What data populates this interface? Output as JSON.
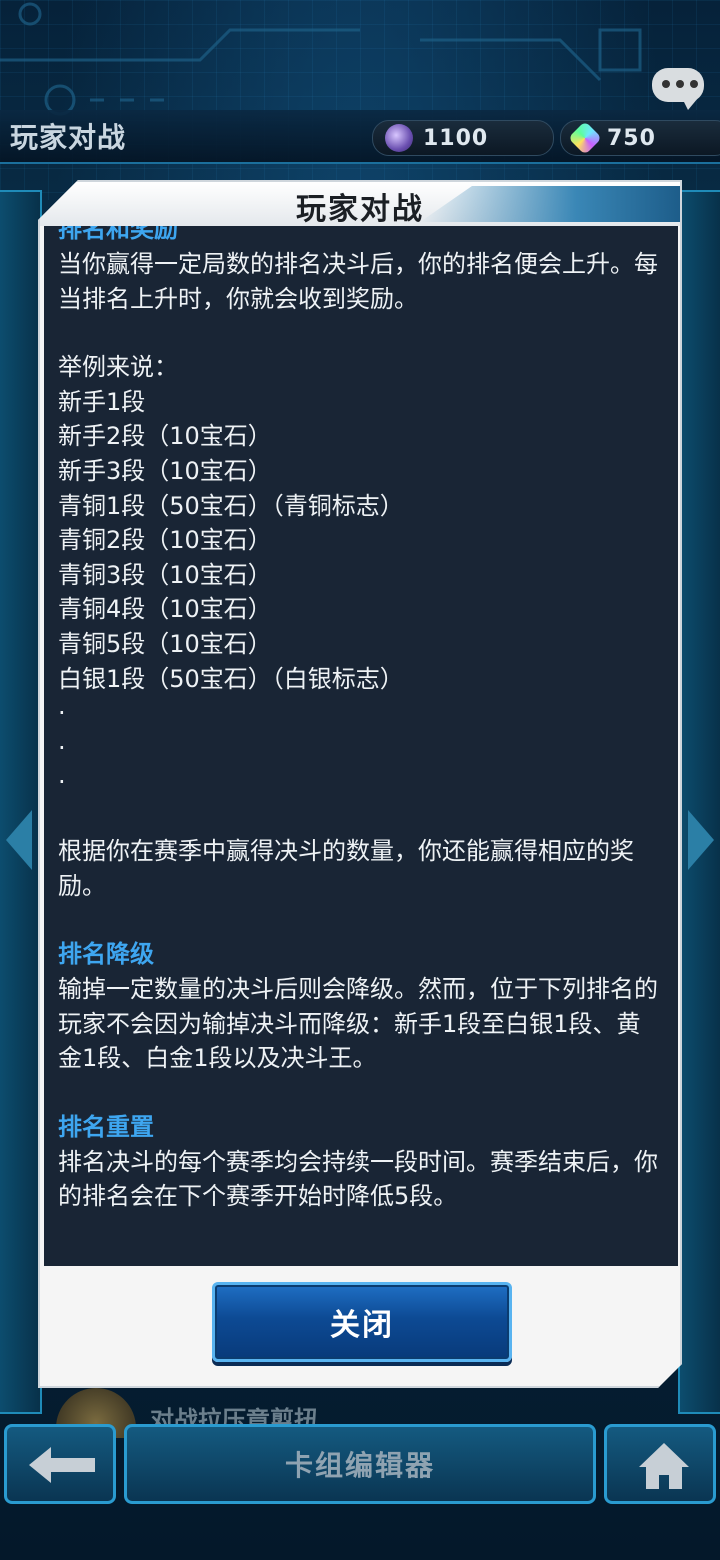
{
  "screen": {
    "title": "玩家对战",
    "currency": [
      {
        "icon": "orb-icon",
        "value": "1100"
      },
      {
        "icon": "gem-icon",
        "value": "750"
      }
    ],
    "bottom_peek_text": "对战拉压竟剪扭"
  },
  "nav": {
    "deck_editor_label": "卡组编辑器"
  },
  "dialog": {
    "title": "玩家对战",
    "sections": [
      {
        "heading": "排名和奖励",
        "paragraphs": [
          "当你赢得一定局数的排名决斗后，你的排名便会上升。每当排名上升时，你就会收到奖励。",
          "举例来说：\n新手1段\n新手2段（10宝石）\n新手3段（10宝石）\n青铜1段（50宝石）（青铜标志）\n青铜2段（10宝石）\n青铜3段（10宝石）\n青铜4段（10宝石）\n青铜5段（10宝石）\n白银1段（50宝石）（白银标志）\n·\n·\n·",
          "根据你在赛季中赢得决斗的数量，你还能赢得相应的奖励。"
        ]
      },
      {
        "heading": "排名降级",
        "paragraphs": [
          "输掉一定数量的决斗后则会降级。然而，位于下列排名的玩家不会因为输掉决斗而降级：新手1段至白银1段、黄金1段、白金1段以及决斗王。"
        ]
      },
      {
        "heading": "排名重置",
        "paragraphs": [
          "排名决斗的每个赛季均会持续一段时间。赛季结束后，你的排名会在下个赛季开始时降低5段。"
        ]
      }
    ],
    "close_label": "关闭"
  },
  "colors": {
    "heading": "#3ea6f0",
    "content_bg": "#192535",
    "button": "#0d4a94"
  }
}
